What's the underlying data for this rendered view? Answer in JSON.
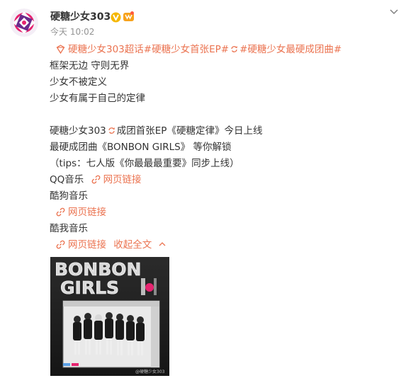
{
  "post": {
    "author": "硬糖少女303",
    "time": "今天 10:02",
    "topic_line": "硬糖少女303超话#硬糖少女首张EP#",
    "topic_line_2": "#硬糖少女最硬成团曲#",
    "lines": {
      "l1": "框架无边 守则无界",
      "l2": "少女不被定义",
      "l3": "少女有属于自己的定律",
      "l4a": "硬糖少女303",
      "l4b": "成团首张EP《硬糖定律》今日上线",
      "l5": "最硬成团曲《BONBON GIRLS》 等你解锁",
      "l6": "（tips：七人版《你最最最重要》同步上线）",
      "qq": "QQ音乐",
      "kugou": "酷狗音乐",
      "kuwo": "酷我音乐"
    },
    "web_link_label": "网页链接",
    "collapse_label": "收起全文"
  },
  "image": {
    "title_line1": "BONBON",
    "title_line2": "GIRLS",
    "watermark": "@硬糖少女303"
  },
  "colors": {
    "link": "#eb7350",
    "verified": "#f5b700",
    "avatar_pink": "#e6236f",
    "avatar_purple": "#6a2a8c"
  },
  "icons": [
    "avatar-logo",
    "verified-icon",
    "vip-icon",
    "more-icon",
    "supertopic-icon",
    "link-icon",
    "loop-icon",
    "chevron-up-icon"
  ]
}
